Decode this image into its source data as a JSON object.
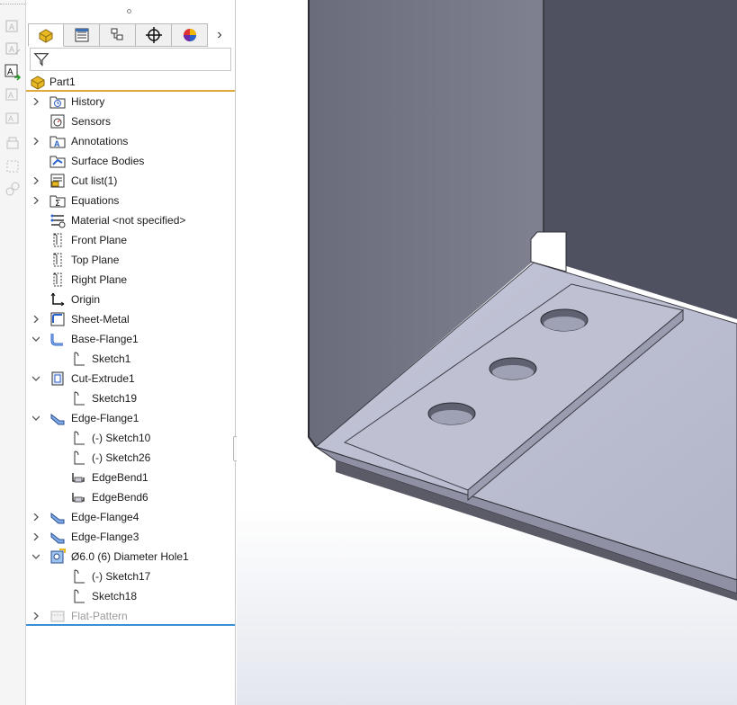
{
  "feature_tabs": [
    {
      "name": "feature-manager",
      "icon": "part-icon"
    },
    {
      "name": "property-manager",
      "icon": "property-list-icon"
    },
    {
      "name": "configuration-manager",
      "icon": "configuration-icon"
    },
    {
      "name": "dimxpert-manager",
      "icon": "crosshair-icon"
    },
    {
      "name": "display-manager",
      "icon": "appearance-icon"
    }
  ],
  "tree": {
    "root": "Part1",
    "items": [
      {
        "label": "History",
        "icon": "history-folder-icon",
        "level": 0,
        "expand": "collapsed"
      },
      {
        "label": "Sensors",
        "icon": "sensors-icon",
        "level": 0,
        "expand": "none"
      },
      {
        "label": "Annotations",
        "icon": "annotations-icon",
        "level": 0,
        "expand": "collapsed"
      },
      {
        "label": "Surface Bodies",
        "icon": "surface-bodies-icon",
        "level": 0,
        "expand": "none"
      },
      {
        "label": "Cut list(1)",
        "icon": "cut-list-icon",
        "level": 0,
        "expand": "collapsed"
      },
      {
        "label": "Equations",
        "icon": "equations-icon",
        "level": 0,
        "expand": "collapsed"
      },
      {
        "label": "Material <not specified>",
        "icon": "material-icon",
        "level": 0,
        "expand": "none"
      },
      {
        "label": "Front Plane",
        "icon": "plane-icon",
        "level": 0,
        "expand": "none"
      },
      {
        "label": "Top Plane",
        "icon": "plane-icon",
        "level": 0,
        "expand": "none"
      },
      {
        "label": "Right Plane",
        "icon": "plane-icon",
        "level": 0,
        "expand": "none"
      },
      {
        "label": "Origin",
        "icon": "origin-icon",
        "level": 0,
        "expand": "none"
      },
      {
        "label": "Sheet-Metal",
        "icon": "sheet-metal-icon",
        "level": 0,
        "expand": "collapsed"
      },
      {
        "label": "Base-Flange1",
        "icon": "base-flange-icon",
        "level": 0,
        "expand": "expanded"
      },
      {
        "label": "Sketch1",
        "icon": "sketch-icon",
        "level": 1,
        "expand": "none"
      },
      {
        "label": "Cut-Extrude1",
        "icon": "cut-extrude-icon",
        "level": 0,
        "expand": "expanded"
      },
      {
        "label": "Sketch19",
        "icon": "sketch-icon",
        "level": 1,
        "expand": "none"
      },
      {
        "label": "Edge-Flange1",
        "icon": "edge-flange-icon",
        "level": 0,
        "expand": "expanded"
      },
      {
        "label": "(-) Sketch10",
        "icon": "sketch-icon",
        "level": 1,
        "expand": "none"
      },
      {
        "label": "(-) Sketch26",
        "icon": "sketch-icon",
        "level": 1,
        "expand": "none"
      },
      {
        "label": "EdgeBend1",
        "icon": "edge-bend-icon",
        "level": 1,
        "expand": "none"
      },
      {
        "label": "EdgeBend6",
        "icon": "edge-bend-icon",
        "level": 1,
        "expand": "none"
      },
      {
        "label": "Edge-Flange4",
        "icon": "edge-flange-icon",
        "level": 0,
        "expand": "collapsed"
      },
      {
        "label": "Edge-Flange3",
        "icon": "edge-flange-icon",
        "level": 0,
        "expand": "collapsed"
      },
      {
        "label": "Ø6.0 (6) Diameter Hole1",
        "icon": "hole-wizard-icon",
        "level": 0,
        "expand": "expanded"
      },
      {
        "label": "(-) Sketch17",
        "icon": "sketch-icon",
        "level": 1,
        "expand": "none"
      },
      {
        "label": "Sketch18",
        "icon": "sketch-icon",
        "level": 1,
        "expand": "none"
      },
      {
        "label": "Flat-Pattern",
        "icon": "flat-pattern-icon",
        "level": 0,
        "expand": "collapsed",
        "suppressed": true
      }
    ]
  },
  "colors": {
    "accent_root_line": "#e0a73d",
    "end_marker_line": "#3a8ed6",
    "model_wall_left": "#7b7d8d",
    "model_wall_back": "#4f5160",
    "model_floor": "#b9bbcf"
  }
}
